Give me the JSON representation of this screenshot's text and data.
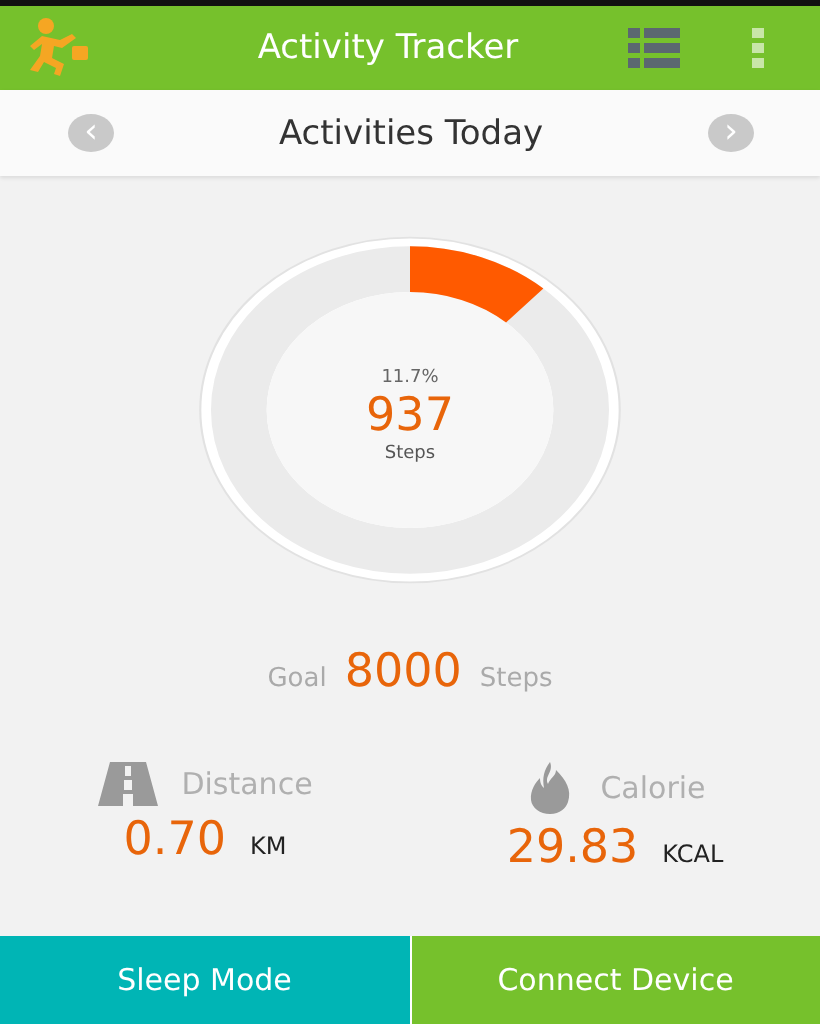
{
  "app_bar": {
    "title": "Activity Tracker"
  },
  "day_nav": {
    "prev": "‹",
    "title": "Activities Today",
    "next": "›"
  },
  "progress": {
    "percent": "11.7%",
    "steps": "937",
    "unit": "Steps",
    "level": 0.117
  },
  "goal": {
    "label": "Goal",
    "value": "8000",
    "unit": "Steps"
  },
  "stats": [
    {
      "kind": "distance",
      "label": "Distance",
      "value": "0.70",
      "unit": "KM"
    },
    {
      "kind": "calorie",
      "label": "Calorie",
      "value": "29.83",
      "unit": "KCAL"
    }
  ],
  "buttons": [
    {
      "label": "Sleep Mode",
      "kind": "sleep"
    },
    {
      "label": "Connect Device",
      "kind": "connect"
    }
  ]
}
